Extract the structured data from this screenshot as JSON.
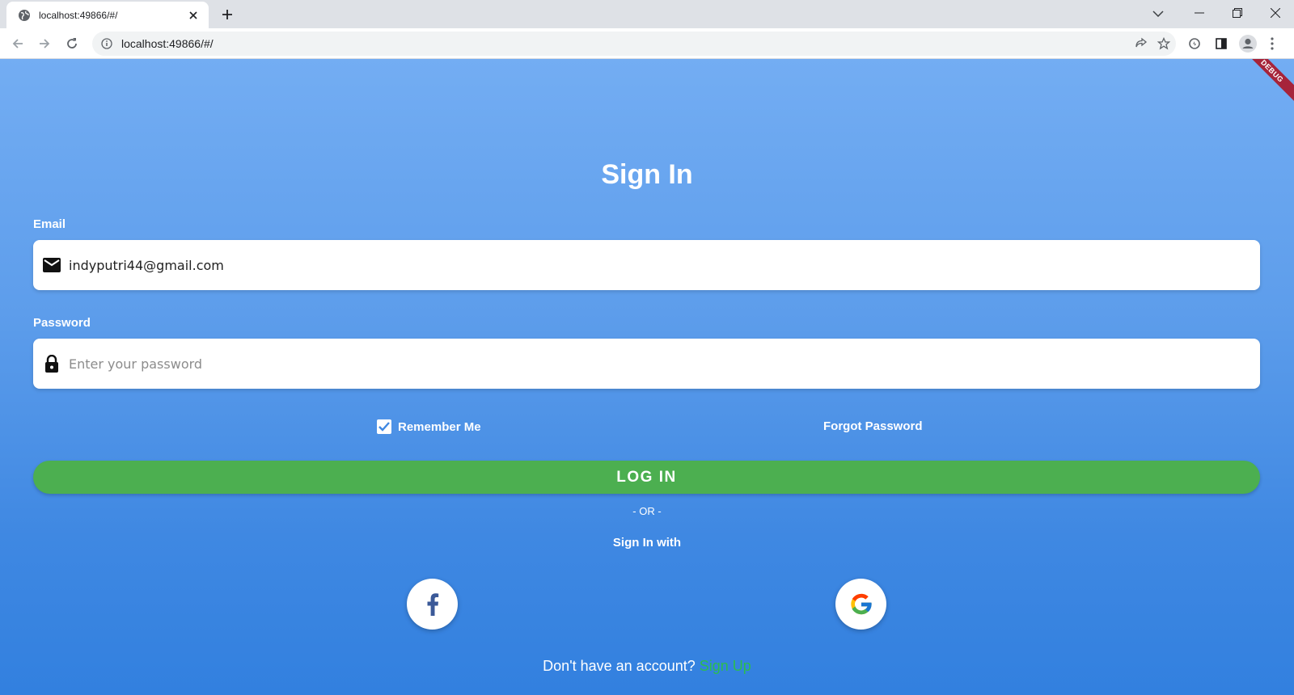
{
  "browser": {
    "tab_title": "localhost:49866/#/",
    "url": "localhost:49866/#/"
  },
  "app": {
    "debug_banner": "DEBUG",
    "title": "Sign In",
    "email": {
      "label": "Email",
      "value": "indyputri44@gmail.com",
      "icon": "mail-icon"
    },
    "password": {
      "label": "Password",
      "placeholder": "Enter your password",
      "icon": "lock-icon"
    },
    "remember_me": {
      "label": "Remember Me",
      "checked": true
    },
    "forgot_password": "Forgot Password",
    "login_button": "LOG IN",
    "or_divider": "- OR -",
    "sign_in_with": "Sign In with",
    "social": [
      "facebook-icon",
      "google-icon"
    ],
    "signup_prompt": "Don't have an account?",
    "signup_link": "Sign Up"
  },
  "colors": {
    "gradient_top": "#73adf3",
    "gradient_bottom": "#3280df",
    "login_green": "#4caf50",
    "signup_link_green": "#2bbd4f",
    "facebook_blue": "#3b5998",
    "debug_red": "#a6243a"
  }
}
